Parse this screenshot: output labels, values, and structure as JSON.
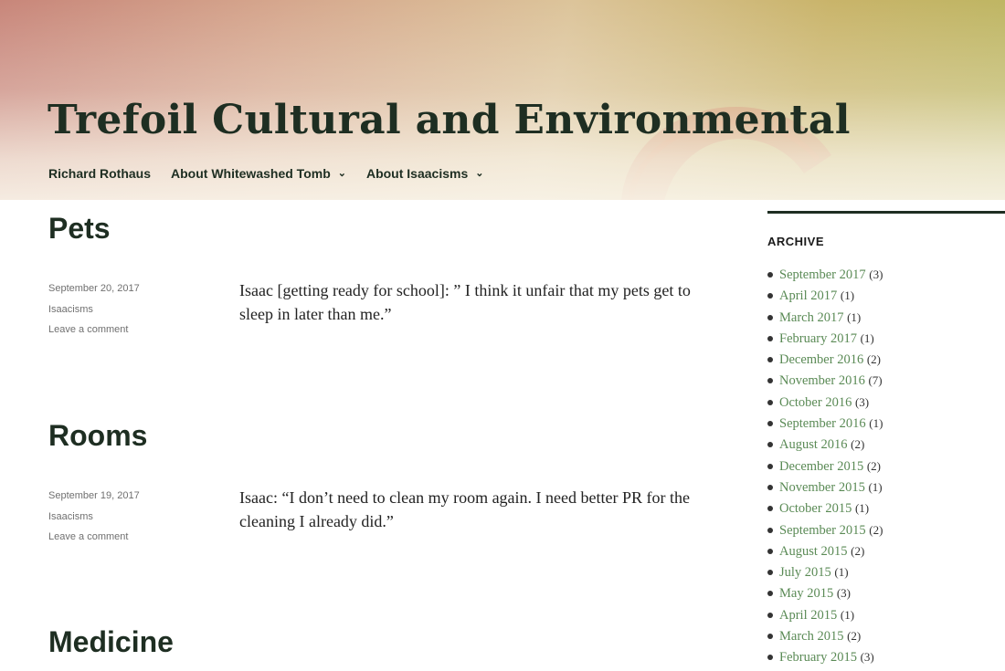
{
  "site": {
    "title": "Trefoil Cultural and Environmental"
  },
  "nav": [
    {
      "label": "Richard Rothaus",
      "has_dropdown": false
    },
    {
      "label": "About Whitewashed Tomb",
      "has_dropdown": true
    },
    {
      "label": "About Isaacisms",
      "has_dropdown": true
    }
  ],
  "posts": [
    {
      "title": "Pets",
      "date": "September 20, 2017",
      "category": "Isaacisms",
      "comment_link": "Leave a comment",
      "excerpt": "Isaac [getting ready for school]: ” I think it unfair that my pets get to sleep in later than me.”"
    },
    {
      "title": "Rooms",
      "date": "September 19, 2017",
      "category": "Isaacisms",
      "comment_link": "Leave a comment",
      "excerpt": "Isaac: “I don’t need to clean my room again. I need better PR for the cleaning I already did.”"
    },
    {
      "title": "Medicine"
    }
  ],
  "sidebar": {
    "archive_title": "ARCHIVE",
    "archive": [
      {
        "label": "September 2017",
        "count": "(3)"
      },
      {
        "label": "April 2017",
        "count": "(1)"
      },
      {
        "label": "March 2017",
        "count": "(1)"
      },
      {
        "label": "February 2017",
        "count": "(1)"
      },
      {
        "label": "December 2016",
        "count": "(2)"
      },
      {
        "label": "November 2016",
        "count": "(7)"
      },
      {
        "label": "October 2016",
        "count": "(3)"
      },
      {
        "label": "September 2016",
        "count": "(1)"
      },
      {
        "label": "August 2016",
        "count": "(2)"
      },
      {
        "label": "December 2015",
        "count": "(2)"
      },
      {
        "label": "November 2015",
        "count": "(1)"
      },
      {
        "label": "October 2015",
        "count": "(1)"
      },
      {
        "label": "September 2015",
        "count": "(2)"
      },
      {
        "label": "August 2015",
        "count": "(2)"
      },
      {
        "label": "July 2015",
        "count": "(1)"
      },
      {
        "label": "May 2015",
        "count": "(3)"
      },
      {
        "label": "April 2015",
        "count": "(1)"
      },
      {
        "label": "March 2015",
        "count": "(2)"
      },
      {
        "label": "February 2015",
        "count": "(3)"
      }
    ]
  },
  "colors": {
    "title_text": "#1e2e22",
    "link_green": "#5a8a55",
    "meta_gray": "#707070"
  },
  "icons": {
    "dropdown": "chevron-down-icon"
  }
}
